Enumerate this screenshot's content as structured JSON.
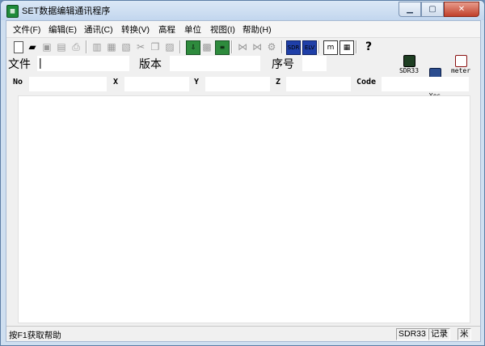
{
  "window": {
    "title": "SET数据编辑通讯程序",
    "icon_glyph": "▦"
  },
  "menu": [
    "文件(F)",
    "编辑(E)",
    "通讯(C)",
    "转换(V)",
    "高程",
    "单位",
    "视图(I)",
    "帮助(H)"
  ],
  "toolbar_icons": [
    "new-file-icon",
    "open-folder-icon",
    "save-icon",
    "save-all-icon",
    "print-icon",
    "cut-doc-icon",
    "edit-doc-icon",
    "paste-doc-icon",
    "scissors-icon",
    "copy-icon",
    "paste-icon",
    "receive-icon",
    "export-icon",
    "book-icon",
    "send-data-icon",
    "transfer-icon",
    "convert-icon",
    "sdr-icon",
    "elevation-icon",
    "meter-table-icon",
    "calculator-icon",
    "help-icon"
  ],
  "fields": {
    "file_label": "文件",
    "file_value": "|",
    "version_label": "版本",
    "serial_label": "序号",
    "no_label": "No",
    "x_label": "X",
    "y_label": "Y",
    "z_label": "Z",
    "code_label": "Code"
  },
  "mode_icons": {
    "sdr": {
      "label": "SDR33",
      "glyph": "33"
    },
    "elev": {
      "label": "Elev\nYes",
      "glyph": "↕"
    },
    "meter": {
      "label": "meter",
      "glyph": "m"
    }
  },
  "status": {
    "help": "按F1获取帮助",
    "format": "SDR33",
    "record": "记录",
    "unit": "米"
  }
}
